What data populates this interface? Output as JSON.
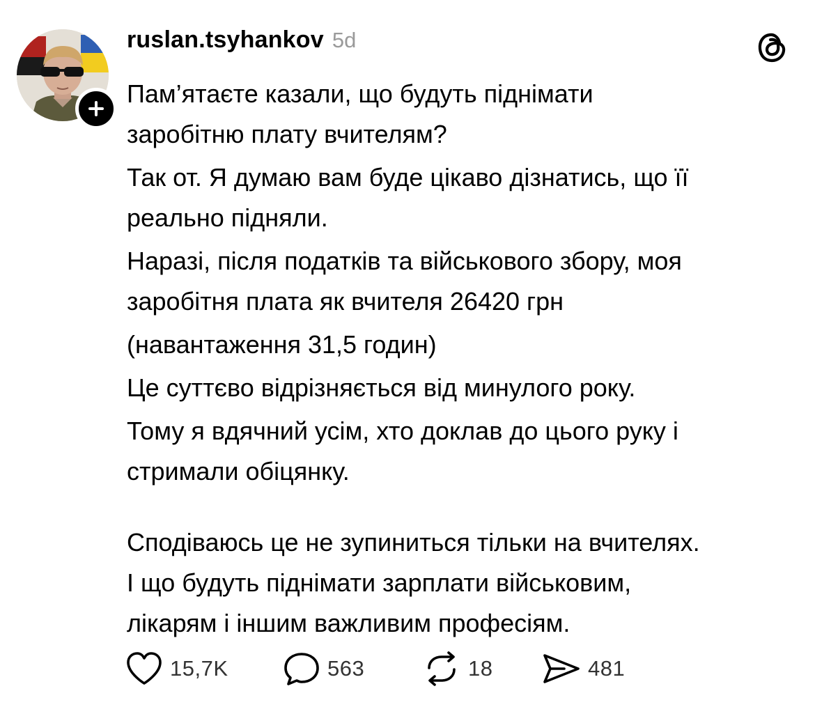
{
  "post": {
    "username": "ruslan.tsyhankov",
    "timestamp": "5d",
    "paragraphs": [
      [
        "Пам’ятаєте казали, що будуть піднімати",
        "заробітню плату вчителям?"
      ],
      [
        "Так от. Я думаю вам буде цікаво дізнатись, що її",
        "реально підняли."
      ],
      [
        "Наразі, після податків та військового збору, моя",
        "заробітня плата як вчителя 26420 грн"
      ],
      [
        "(навантаження 31,5 годин)"
      ],
      [
        "Це суттєво відрізняється від минулого року."
      ],
      [
        "Тому я вдячний усім, хто доклав до цього руку і",
        "стримали обіцянку."
      ],
      [
        "Сподіваюсь це не зупиниться тільки на вчителях.",
        "І що будуть піднімати зарплати військовим,",
        "лікарям і іншим важливим професіям."
      ]
    ]
  },
  "actions": {
    "likes": "15,7K",
    "comments": "563",
    "reposts": "18",
    "shares": "481"
  },
  "icons": {
    "avatar": "user-avatar",
    "follow": "plus-icon",
    "brand": "threads-logo-icon",
    "like": "heart-icon",
    "comment": "comment-bubble-icon",
    "repost": "repost-icon",
    "share": "send-icon"
  },
  "colors": {
    "text": "#000000",
    "muted": "#9a9a9a",
    "counts": "#333333"
  }
}
